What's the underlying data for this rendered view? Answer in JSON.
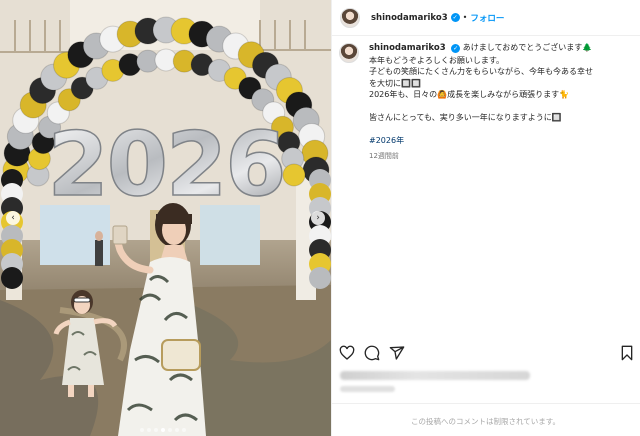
{
  "post": {
    "username": "shinodamariko3",
    "verified_icon": "verified-badge-icon",
    "separator": "•",
    "follow_label": "フォロー",
    "caption_lines": [
      "あけましておめでとうございます🌲",
      "本年もどうぞよろしくお願いします。",
      "子どもの笑顔にたくさん力をもらいながら、今年も今ある幸せ",
      "を大切に🔲🔲",
      "2026年も、日々の🙆成長を楽しみながら頑張ります🐈",
      "",
      "皆さんにとっても、実り多い一年になりますように🔲"
    ],
    "hashtag": "#2026年",
    "time_ago": "12週間前",
    "comments_restricted": "この投稿へのコメントは制限されています。"
  },
  "photo": {
    "balloon_text": "2026",
    "prev_icon": "‹",
    "next_icon": "›",
    "carousel_count": 7,
    "carousel_active": 3
  },
  "actions": [
    "heart-icon",
    "comment-icon",
    "share-icon",
    "bookmark-icon"
  ],
  "colors": {
    "accent": "#0095f6",
    "hashtag": "#00376b",
    "muted": "#737373"
  }
}
